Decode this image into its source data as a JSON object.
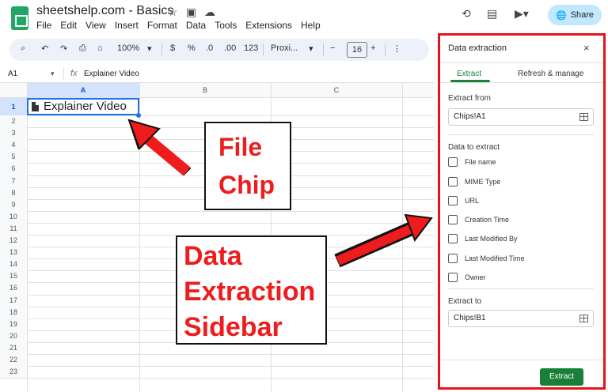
{
  "header": {
    "doc_title": "sheetshelp.com - Basics",
    "menu": [
      "File",
      "Edit",
      "View",
      "Insert",
      "Format",
      "Data",
      "Tools",
      "Extensions",
      "Help"
    ],
    "share_label": "Share"
  },
  "toolbar": {
    "zoom": "100%",
    "currency": "$",
    "percent": "%",
    "dec_decrease": ".0",
    "dec_increase": ".00",
    "more_formats": "123",
    "font": "Proxi...",
    "font_size": "16",
    "minus": "−",
    "plus": "+"
  },
  "formula_bar": {
    "name_box": "A1",
    "fx": "fx",
    "value": "Explainer Video"
  },
  "grid": {
    "columns": [
      "A",
      "B",
      "C"
    ],
    "rows": [
      "1",
      "2",
      "3",
      "4",
      "5",
      "6",
      "7",
      "8",
      "9",
      "10",
      "11",
      "12",
      "13",
      "14",
      "15",
      "16",
      "17",
      "18",
      "19",
      "20",
      "21",
      "22",
      "23"
    ],
    "a1_chip": "Explainer Video"
  },
  "callouts": {
    "file_chip": [
      "File",
      "Chip"
    ],
    "sidebar": [
      "Data",
      "Extraction",
      "Sidebar"
    ]
  },
  "sidebar": {
    "title": "Data extraction",
    "close": "×",
    "tab_extract": "Extract",
    "tab_refresh": "Refresh & manage",
    "extract_from_label": "Extract from",
    "extract_from_value": "Chips!A1",
    "data_to_extract_label": "Data to extract",
    "options": [
      "File name",
      "MIME Type",
      "URL",
      "Creation Time",
      "Last Modified By",
      "Last Modified Time",
      "Owner"
    ],
    "extract_to_label": "Extract to",
    "extract_to_value": "Chips!B1",
    "extract_button": "Extract"
  },
  "colors": {
    "accent_green": "#188038",
    "callout_red": "#ee1c1c",
    "selection_blue": "#1a73e8"
  }
}
